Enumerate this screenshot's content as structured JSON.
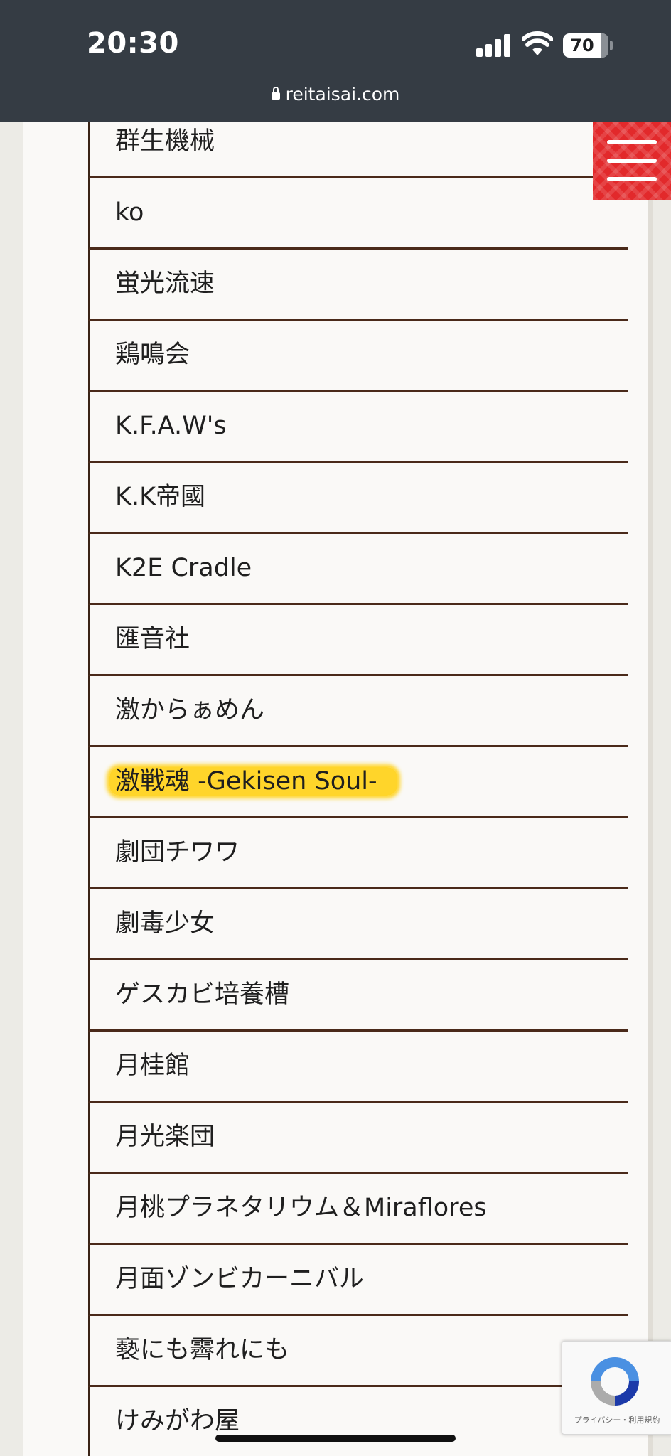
{
  "status_bar": {
    "time": "20:30",
    "battery": "70",
    "url": "reitaisai.com"
  },
  "circles": [
    {
      "name": "群生機械"
    },
    {
      "name": "ko"
    },
    {
      "name": "蛍光流速"
    },
    {
      "name": "鶏鳴会"
    },
    {
      "name": "K.F.A.W's"
    },
    {
      "name": "K.K帝國"
    },
    {
      "name": "K2E Cradle"
    },
    {
      "name": "匯音社"
    },
    {
      "name": "激からぁめん"
    },
    {
      "name": "激戦魂 -Gekisen Soul-",
      "highlighted": true
    },
    {
      "name": "劇団チワワ"
    },
    {
      "name": "劇毒少女"
    },
    {
      "name": "ゲスカビ培養槽"
    },
    {
      "name": "月桂館"
    },
    {
      "name": "月光楽団"
    },
    {
      "name": "月桃プラネタリウム＆Miraflores"
    },
    {
      "name": "月面ゾンビカーニバル"
    },
    {
      "name": "褻にも霽れにも"
    },
    {
      "name": "けみがわ屋"
    }
  ],
  "recaptcha": {
    "links": "プライバシー・利用規約"
  },
  "colors": {
    "header_bg": "#353c44",
    "menu_button": "#e2292b",
    "highlight": "#ffd52a",
    "divider": "#4a2a1a"
  },
  "icons": {
    "menu": "hamburger-icon",
    "lock": "lock-icon",
    "recaptcha": "recaptcha-logo"
  }
}
